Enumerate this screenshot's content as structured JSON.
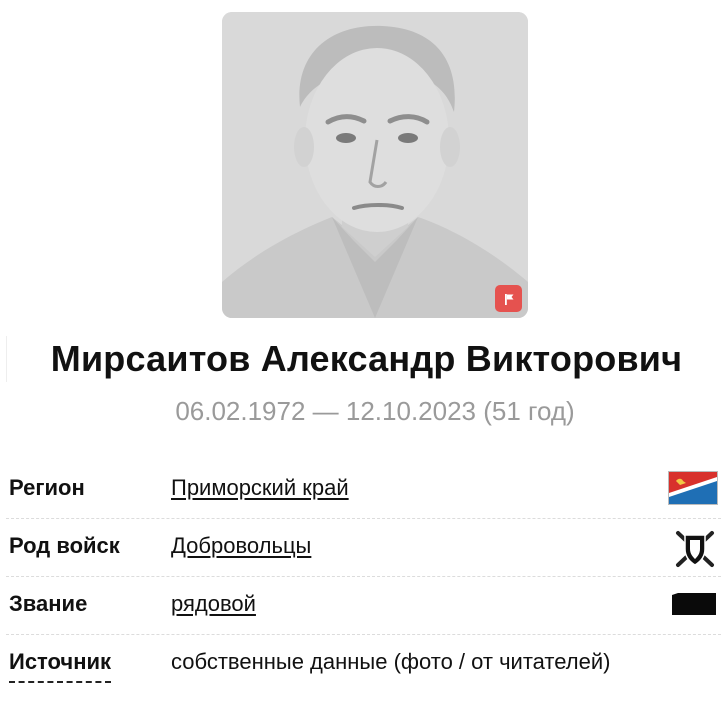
{
  "person": {
    "full_name": "Мирсаитов Александр Викторович",
    "dates": "06.02.1972 — 12.10.2023 (51 год)"
  },
  "photo": {
    "icon": "portrait-photo",
    "flag_icon": "flag-icon",
    "flag_color": "#e5524f"
  },
  "info": {
    "region": {
      "label": "Регион",
      "value": "Приморский край",
      "icon": "primorsky-flag-icon"
    },
    "troops": {
      "label": "Род войск",
      "value": "Добровольцы",
      "icon": "volunteer-emblem-icon"
    },
    "rank": {
      "label": "Звание",
      "value": "рядовой",
      "icon": "rank-insignia-icon"
    },
    "source": {
      "label": "Источник",
      "value": "собственные данные (фото / от читателей)"
    }
  },
  "colors": {
    "region_flag_red": "#d8312c",
    "region_flag_blue": "#1f6fb5",
    "muted_text": "#9a9a9a"
  }
}
